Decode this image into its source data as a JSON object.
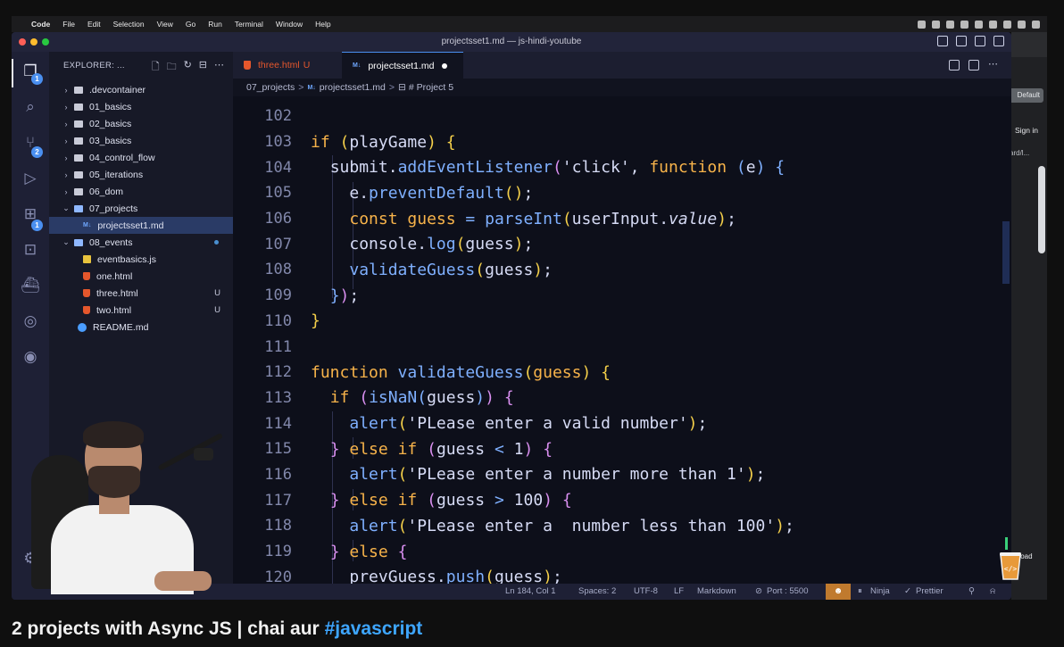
{
  "menubar": {
    "app": "Code",
    "items": [
      "File",
      "Edit",
      "Selection",
      "View",
      "Go",
      "Run",
      "Terminal",
      "Window",
      "Help"
    ]
  },
  "window": {
    "title": "projectsset1.md — js-hindi-youtube"
  },
  "activity": {
    "explorer_badge": "1",
    "scm_badge": "2",
    "ext_badge": "1",
    "settings_badge": "1"
  },
  "sidebar": {
    "header": "EXPLORER: ...",
    "items": [
      {
        "label": ".devcontainer",
        "type": "folder"
      },
      {
        "label": "01_basics",
        "type": "folder"
      },
      {
        "label": "02_basics",
        "type": "folder"
      },
      {
        "label": "03_basics",
        "type": "folder"
      },
      {
        "label": "04_control_flow",
        "type": "folder"
      },
      {
        "label": "05_iterations",
        "type": "folder"
      },
      {
        "label": "06_dom",
        "type": "folder"
      },
      {
        "label": "07_projects",
        "type": "folder-open"
      },
      {
        "label": "projectsset1.md",
        "type": "md"
      },
      {
        "label": "08_events",
        "type": "folder-open"
      },
      {
        "label": "eventbasics.js",
        "type": "js"
      },
      {
        "label": "one.html",
        "type": "html"
      },
      {
        "label": "three.html",
        "type": "html",
        "status": "U"
      },
      {
        "label": "two.html",
        "type": "html",
        "status": "U"
      },
      {
        "label": "README.md",
        "type": "info"
      }
    ]
  },
  "tabs": [
    {
      "label": "three.html",
      "status": "U"
    },
    {
      "label": "projectsset1.md",
      "md_icon": "M↓"
    }
  ],
  "breadcrumb": {
    "folder": "07_projects",
    "file": "projectsset1.md",
    "section": "# Project 5",
    "md_icon": "M↓",
    "sep": ">",
    "section_icon": "⊟"
  },
  "code": {
    "line_numbers": [
      "102",
      "103",
      "104",
      "105",
      "106",
      "107",
      "108",
      "109",
      "110",
      "111",
      "112",
      "113",
      "114",
      "115",
      "116",
      "117",
      "118",
      "119",
      "120"
    ]
  },
  "statusbar": {
    "position": "Ln 184, Col 1",
    "spaces": "Spaces: 2",
    "encoding": "UTF-8",
    "eol": "LF",
    "language": "Markdown",
    "port": "Port : 5500",
    "ninja": "Ninja",
    "prettier": "Prettier"
  },
  "browser": {
    "default": "Default",
    "sign_in": "Sign in",
    "url": "ard/l...",
    "reload": "eload"
  },
  "video": {
    "title": "2 projects with Async JS | chai aur ",
    "hashtag": "#javascript"
  },
  "colors": {
    "keyword": "#f7b34a",
    "function": "#7fb0ff",
    "bracket": "#f5d04a",
    "accent": "#4a8ff0",
    "hashtag": "#3ea6ff"
  }
}
